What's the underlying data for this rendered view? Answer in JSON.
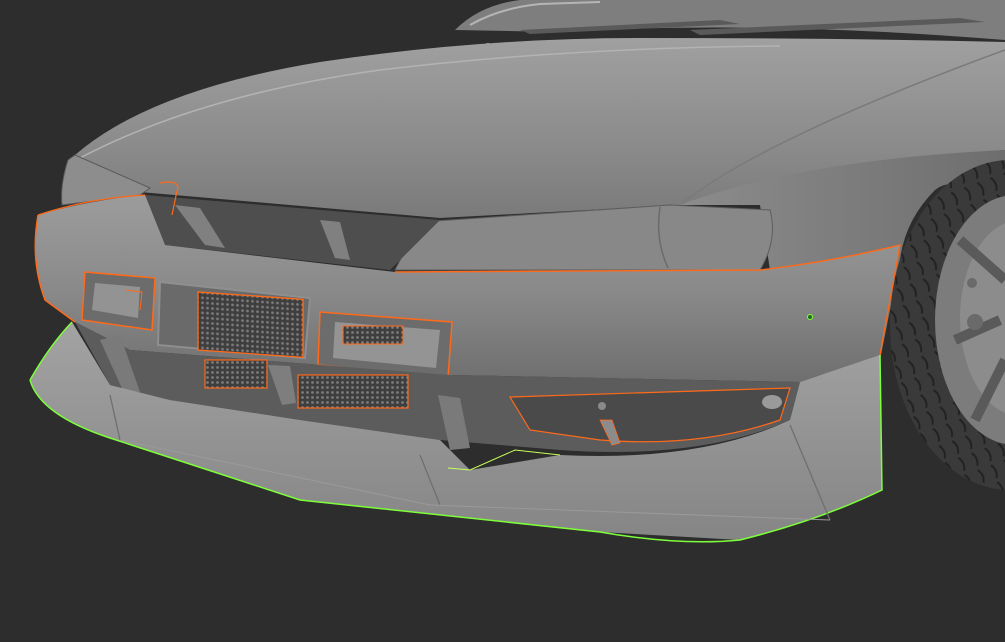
{
  "viewport": {
    "background": "#2d2d2d"
  },
  "colors": {
    "body_base": "#8a8a8a",
    "body_dark": "#5e5e5e",
    "body_light": "#a6a6a6",
    "selection_outline": "#ff6a1a",
    "active_outline": "#7dff3a",
    "tire": "#3c3c3c"
  },
  "scene": {
    "object": "car-front-model",
    "selected_parts": [
      "bumper",
      "headlights",
      "grille",
      "fog-light-left",
      "fog-light-right",
      "intercooler",
      "lower-vents"
    ],
    "active_part": "front-lip-splitter"
  }
}
